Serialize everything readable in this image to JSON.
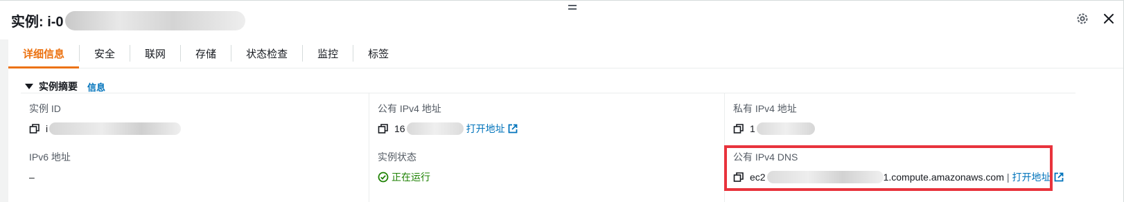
{
  "header": {
    "title_prefix": "实例: i-0",
    "icons": [
      "settings-icon",
      "close-icon"
    ]
  },
  "tabs": [
    {
      "label": "详细信息",
      "active": true
    },
    {
      "label": "安全",
      "active": false
    },
    {
      "label": "联网",
      "active": false
    },
    {
      "label": "存储",
      "active": false
    },
    {
      "label": "状态检查",
      "active": false
    },
    {
      "label": "监控",
      "active": false
    },
    {
      "label": "标签",
      "active": false
    }
  ],
  "summary": {
    "title": "实例摘要",
    "info_link": "信息"
  },
  "fields": {
    "instance_id": {
      "label": "实例 ID",
      "value_visible": "i"
    },
    "public_ipv4": {
      "label": "公有 IPv4 地址",
      "value_visible": "16",
      "link": "打开地址"
    },
    "private_ipv4": {
      "label": "私有 IPv4 地址",
      "value_visible": "1"
    },
    "ipv6": {
      "label": "IPv6 地址",
      "value": "–"
    },
    "instance_state": {
      "label": "实例状态",
      "value": "正在运行"
    },
    "public_dns": {
      "label": "公有 IPv4 DNS",
      "value_prefix": "ec2",
      "value_suffix": "1.compute.amazonaws.com",
      "separator": "|",
      "link": "打开地址"
    }
  },
  "colors": {
    "accent": "#ec7211",
    "link": "#0073bb",
    "success": "#1d8102",
    "highlight": "#e8333c"
  }
}
